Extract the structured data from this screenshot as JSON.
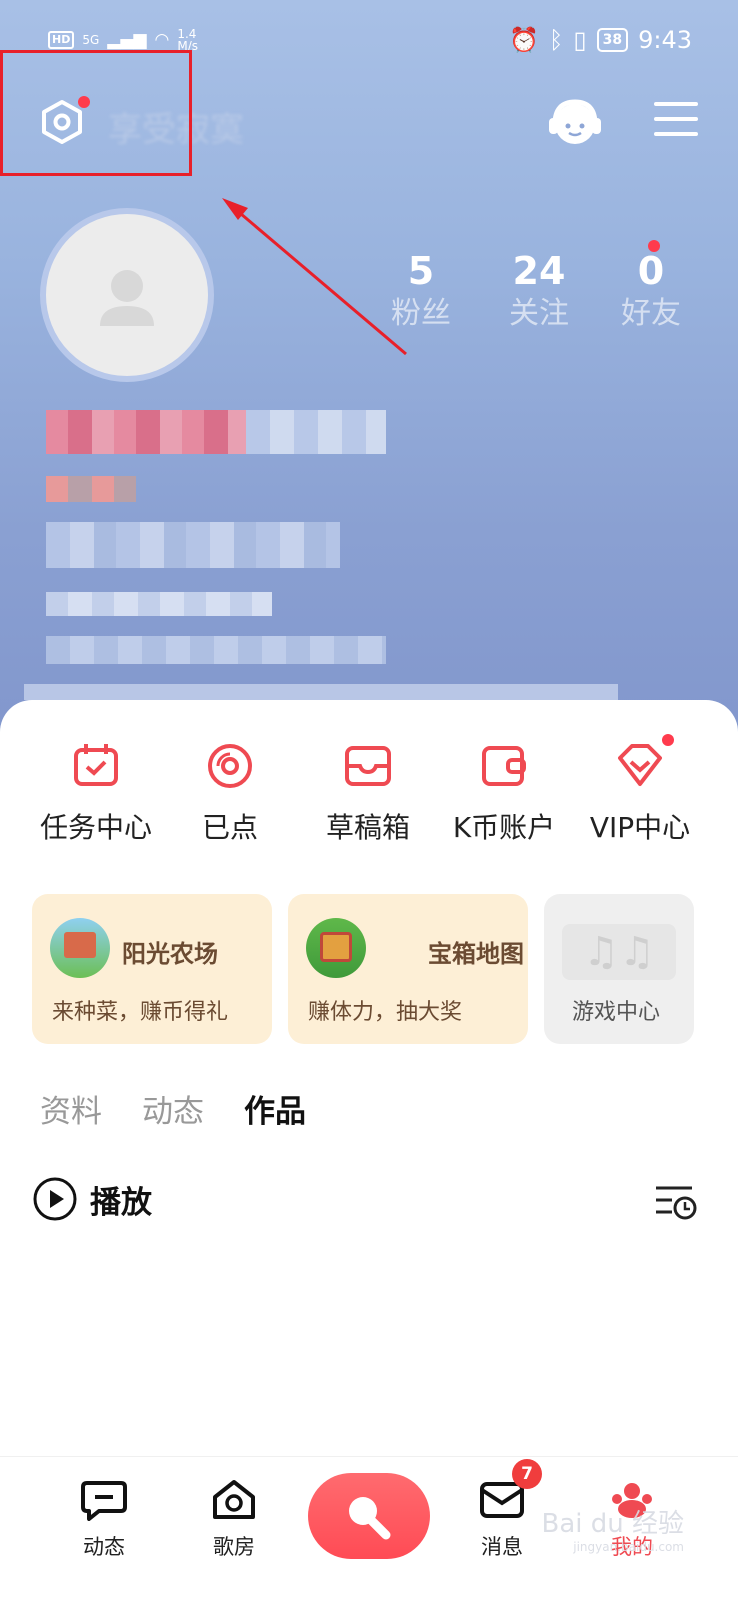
{
  "status_bar": {
    "network_hd": "HD",
    "network_5g": "5G",
    "speed": "1.4",
    "speed_unit": "M/s",
    "battery": "38",
    "time": "9:43"
  },
  "header": {
    "username_blurred": "享受寂寞"
  },
  "stats": [
    {
      "num": "5",
      "label": "粉丝"
    },
    {
      "num": "24",
      "label": "关注"
    },
    {
      "num": "0",
      "label": "好友"
    }
  ],
  "quick_actions": [
    {
      "label": "任务中心",
      "icon": "calendar-check-icon"
    },
    {
      "label": "已点",
      "icon": "disc-icon"
    },
    {
      "label": "草稿箱",
      "icon": "inbox-icon"
    },
    {
      "label": "K币账户",
      "icon": "wallet-icon"
    },
    {
      "label": "VIP中心",
      "icon": "diamond-icon"
    }
  ],
  "cards": [
    {
      "title": "阳光农场",
      "subtitle": "来种菜，赚币得礼"
    },
    {
      "title": "宝箱地图",
      "subtitle": "赚体力，抽大奖"
    },
    {
      "title": "",
      "subtitle": "游戏中心"
    }
  ],
  "tabs": [
    "资料",
    "动态",
    "作品"
  ],
  "play_label": "播放",
  "bottom_nav": [
    {
      "label": "动态"
    },
    {
      "label": "歌房"
    },
    {
      "label": "消息",
      "badge": "7"
    },
    {
      "label": "我的"
    }
  ],
  "watermark": "Bai du 经验",
  "watermark_sub": "jingyan.baidu.com",
  "colors": {
    "accent": "#ff4b55",
    "highlight_box": "#e8202a",
    "card_bg": "#fdefd6",
    "game_card_bg": "#efefef"
  }
}
